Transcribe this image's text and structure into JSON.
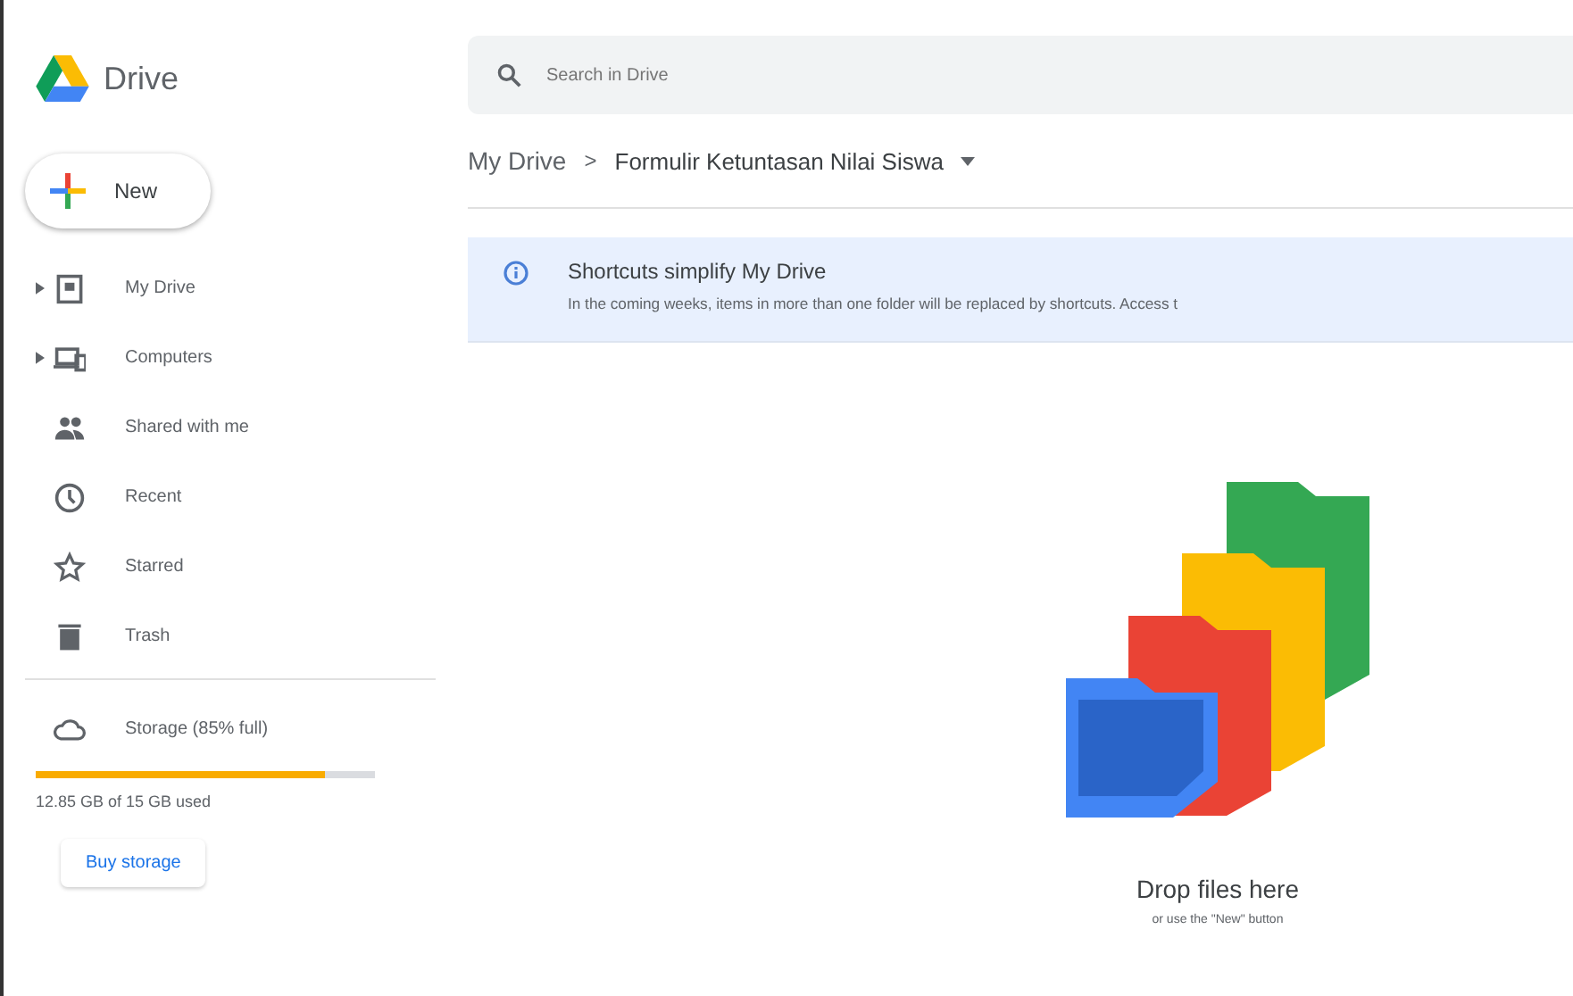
{
  "app": {
    "name": "Drive"
  },
  "search": {
    "placeholder": "Search in Drive"
  },
  "new_button": {
    "label": "New"
  },
  "sidebar": {
    "items": [
      {
        "label": "My Drive",
        "expandable": true
      },
      {
        "label": "Computers",
        "expandable": true
      },
      {
        "label": "Shared with me",
        "expandable": false
      },
      {
        "label": "Recent",
        "expandable": false
      },
      {
        "label": "Starred",
        "expandable": false
      },
      {
        "label": "Trash",
        "expandable": false
      }
    ]
  },
  "storage": {
    "label": "Storage (85% full)",
    "level": 0.85,
    "usage": "12.85 GB of 15 GB used",
    "buy": "Buy storage"
  },
  "breadcrumb": {
    "parent": "My Drive",
    "separator": ">",
    "current": "Formulir Ketuntasan Nilai Siswa"
  },
  "banner": {
    "title": "Shortcuts simplify My Drive",
    "text": "In the coming weeks, items in more than one folder will be replaced by shortcuts. Access t"
  },
  "empty_state": {
    "title": "Drop files here",
    "subtitle": "or use the \"New\" button"
  }
}
